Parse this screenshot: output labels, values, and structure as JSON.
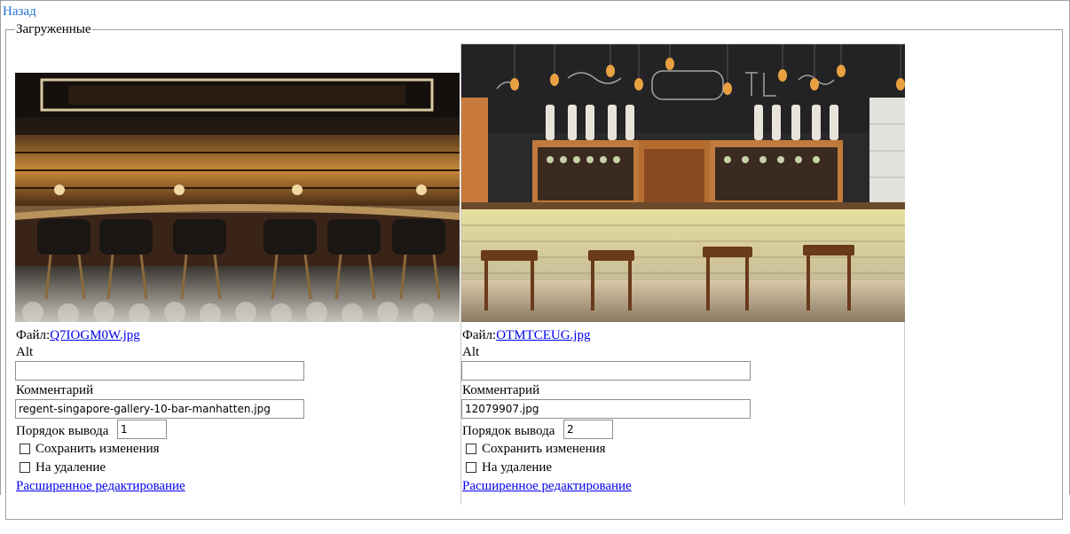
{
  "nav": {
    "back_label": "Назад"
  },
  "section": {
    "legend": "Загруженные"
  },
  "cards": [
    {
      "file_prefix": "Файл:",
      "file_name": "Q7IOGM0W.jpg",
      "alt_label": "Alt",
      "alt_value": "",
      "comment_label": "Комментарий",
      "comment_value": "regent-singapore-gallery-10-bar-manhatten.jpg",
      "order_label": "Порядок вывода",
      "order_value": "1",
      "save_label": "Сохранить изменения",
      "delete_label": "На удаление",
      "advanced_label": "Расширенное редактирование"
    },
    {
      "file_prefix": "Файл:",
      "file_name": "OTMTCEUG.jpg",
      "alt_label": "Alt",
      "alt_value": "",
      "comment_label": "Комментарий",
      "comment_value": "12079907.jpg",
      "order_label": "Порядок вывода",
      "order_value": "2",
      "save_label": "Сохранить изменения",
      "delete_label": "На удаление",
      "advanced_label": "Расширенное редактирование"
    }
  ]
}
